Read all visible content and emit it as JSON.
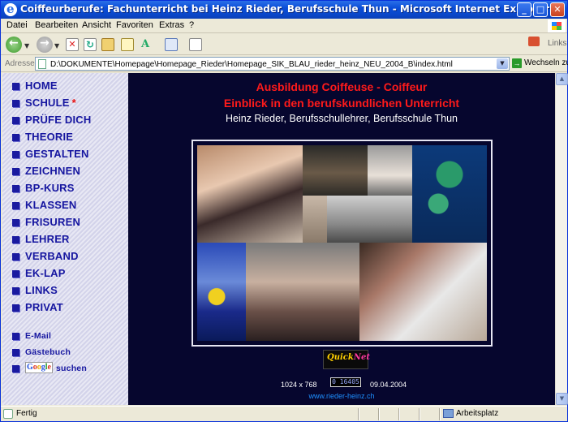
{
  "window": {
    "title": "Coiffeurberufe: Fachunterricht bei Heinz Rieder, Berufsschule Thun - Microsoft Internet Explorer",
    "controls": {
      "minimize": "_",
      "maximize": "□",
      "close": "✕"
    }
  },
  "menu": {
    "items": [
      "Datei",
      "Bearbeiten",
      "Ansicht",
      "Favoriten",
      "Extras",
      "?"
    ]
  },
  "toolbar": {
    "links_label": "Links",
    "icons": [
      "back-icon",
      "forward-icon",
      "stop-icon",
      "refresh-icon",
      "home-icon",
      "favorites-icon",
      "font-icon",
      "mail-icon",
      "edit-icon"
    ]
  },
  "address_bar": {
    "label": "Adresse",
    "value": "D:\\DOKUMENTE\\Homepage\\Homepage_Rieder\\Homepage_SIK_BLAU_rieder_heinz_NEU_2004_B\\index.html",
    "go_label": "Wechseln zu"
  },
  "nav": {
    "items": [
      {
        "label": "HOME"
      },
      {
        "label": "SCHULE",
        "star": "*"
      },
      {
        "label": "PRÜFE DICH"
      },
      {
        "label": "THEORIE"
      },
      {
        "label": "GESTALTEN"
      },
      {
        "label": "ZEICHNEN"
      },
      {
        "label": "BP-KURS"
      },
      {
        "label": "KLASSEN"
      },
      {
        "label": "FRISUREN"
      },
      {
        "label": "LEHRER"
      },
      {
        "label": "VERBAND"
      },
      {
        "label": "EK-LAP"
      },
      {
        "label": "LINKS"
      },
      {
        "label": "PRIVAT"
      }
    ],
    "email": "E-Mail",
    "guestbook": "Gästebuch",
    "google_logo": "Google",
    "search": "suchen"
  },
  "main": {
    "title_line1": "Ausbildung Coiffeuse - Coiffeur",
    "title_line2": "Einblick in den berufskundlichen Unterricht",
    "subtitle": "Heinz Rieder,  Berufsschullehrer, Berufsschule Thun",
    "quicknet_logo": "QuickNet",
    "resolution": "1024 x 768",
    "counter": "0 16405",
    "date": "09.04.2004",
    "site": "www.rieder-heinz.ch"
  },
  "status": {
    "text": "Fertig",
    "zone": "Arbeitsplatz"
  },
  "colors": {
    "title_red": "#ff1a1a",
    "nav_blue": "#1616a0",
    "main_bg": "#06062e",
    "link_blue": "#1e90ff"
  }
}
